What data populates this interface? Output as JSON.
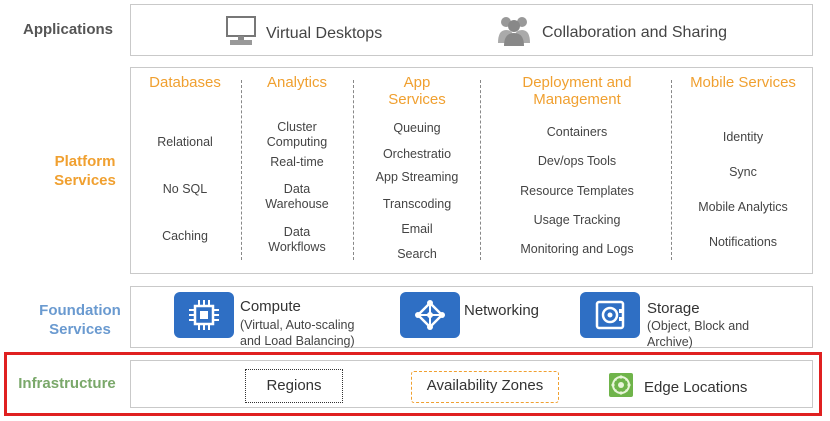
{
  "applications": {
    "label": "Applications",
    "items": [
      {
        "label": "Virtual Desktops",
        "icon": "desktop-icon"
      },
      {
        "label": "Collaboration and Sharing",
        "icon": "people-icon"
      }
    ]
  },
  "platform": {
    "label_line1": "Platform",
    "label_line2": "Services",
    "columns": [
      {
        "title": [
          "Databases"
        ],
        "items": [
          "Relational",
          "No SQL",
          "Caching"
        ]
      },
      {
        "title": [
          "Analytics"
        ],
        "items": [
          "Cluster\nComputing",
          "Real-time",
          "Data\nWarehouse",
          "Data\nWorkflows"
        ]
      },
      {
        "title": [
          "App",
          "Services"
        ],
        "items": [
          "Queuing",
          "Orchestratio",
          "App Streaming",
          "Transcoding",
          "Email",
          "Search"
        ]
      },
      {
        "title": [
          "Deployment and",
          "Management"
        ],
        "items": [
          "Containers",
          "Dev/ops Tools",
          "Resource Templates",
          "Usage Tracking",
          "Monitoring and Logs"
        ]
      },
      {
        "title": [
          "Mobile Services"
        ],
        "items": [
          "Identity",
          "Sync",
          "Mobile Analytics",
          "Notifications"
        ]
      }
    ]
  },
  "foundation": {
    "label_line1": "Foundation",
    "label_line2": "Services",
    "items": [
      {
        "title": "Compute",
        "sub1": "(Virtual, Auto-scaling",
        "sub2": "and Load Balancing)",
        "icon": "chip-icon"
      },
      {
        "title": "Networking",
        "sub1": "",
        "sub2": "",
        "icon": "network-icon"
      },
      {
        "title": "Storage",
        "sub1": "(Object, Block and",
        "sub2": "Archive)",
        "icon": "vault-icon"
      }
    ]
  },
  "infrastructure": {
    "label": "Infrastructure",
    "regions": "Regions",
    "zones": "Availability Zones",
    "edge": "Edge Locations",
    "edge_icon": "edge-location-icon"
  },
  "colors": {
    "platform_accent": "#f0a030",
    "foundation_accent": "#6a9ad0",
    "infrastructure_accent": "#7aa86a",
    "icon_blue": "#2f6fc4",
    "highlight_frame": "#e02020"
  }
}
